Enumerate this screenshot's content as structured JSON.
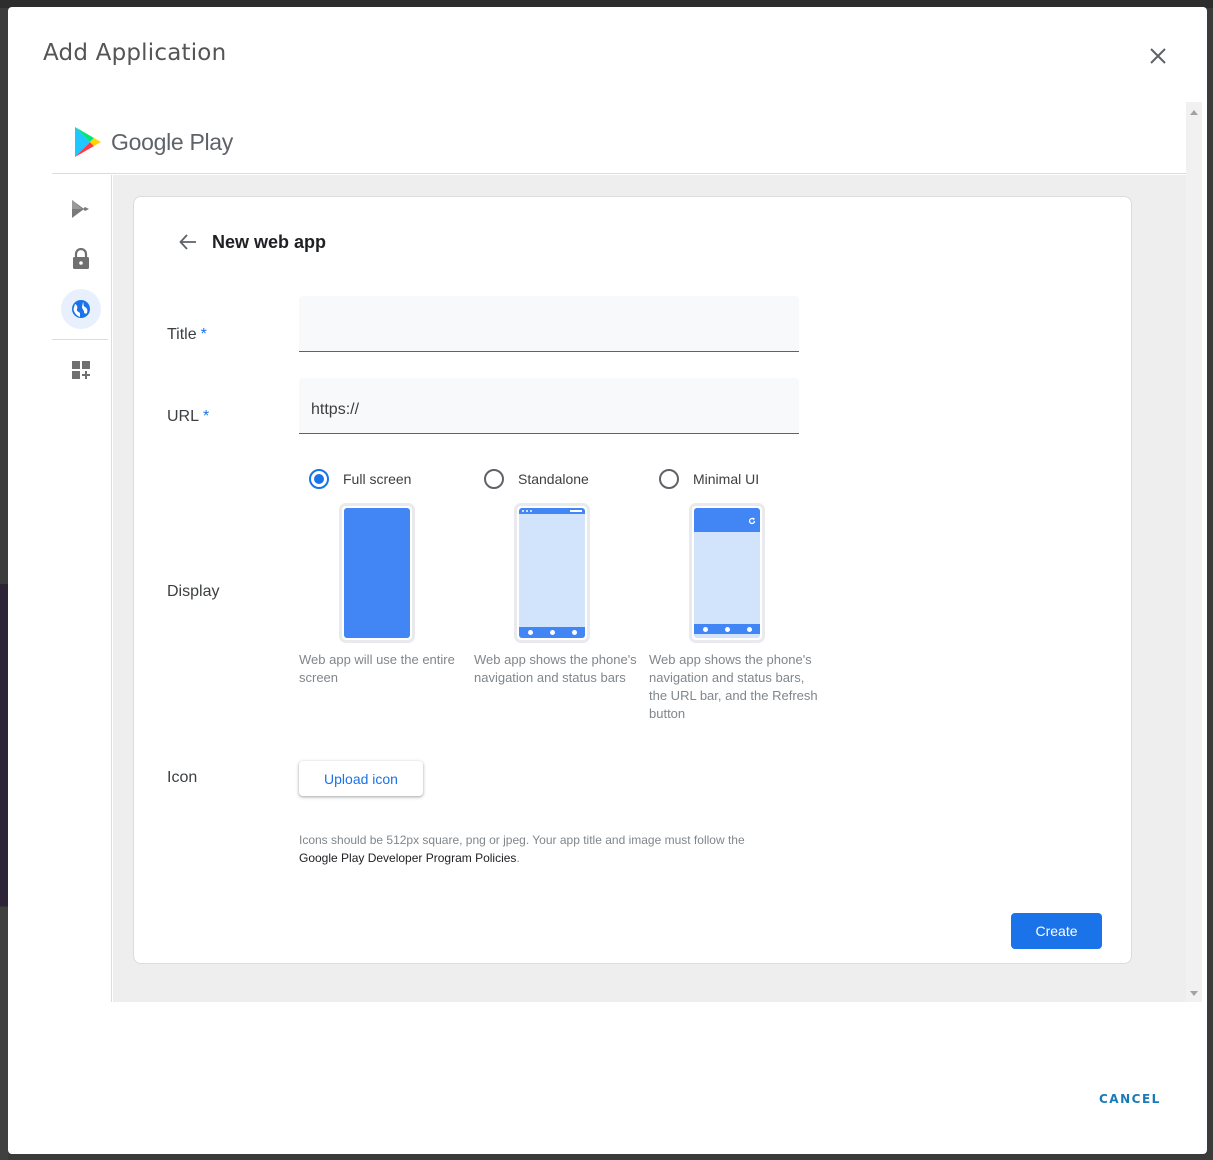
{
  "dialog": {
    "title": "Add Application",
    "close_icon": "close-icon",
    "cancel_label": "CANCEL"
  },
  "google_play": {
    "logo_text": "Google Play",
    "logo_icon": "google-play-logo-icon"
  },
  "rail": {
    "items": [
      {
        "name": "managed-play-apps",
        "icon": "play-apps-icon",
        "active": false
      },
      {
        "name": "private-apps",
        "icon": "lock-icon",
        "active": false
      },
      {
        "name": "web-apps",
        "icon": "globe-icon",
        "active": true
      },
      {
        "name": "organize-apps",
        "icon": "apps-add-icon",
        "active": false
      }
    ]
  },
  "form": {
    "back_icon": "arrow-back-icon",
    "heading": "New web app",
    "required_marker": "*",
    "title_field": {
      "label": "Title",
      "value": "",
      "required": true
    },
    "url_field": {
      "label": "URL",
      "value": "https://",
      "required": true
    },
    "display": {
      "label": "Display",
      "selected": "Full screen",
      "options": [
        {
          "label": "Full screen",
          "checked": true,
          "description": "Web app will use the entire screen"
        },
        {
          "label": "Standalone",
          "checked": false,
          "description": "Web app shows the phone's navigation and status bars"
        },
        {
          "label": "Minimal UI",
          "checked": false,
          "description": "Web app shows the phone's navigation and status bars, the URL bar, and the Refresh button"
        }
      ]
    },
    "icon": {
      "label": "Icon",
      "upload_label": "Upload icon",
      "help_text": "Icons should be 512px square, png or jpeg. Your app title and image must follow the",
      "policy_link": "Google Play Developer Program Policies",
      "help_suffix": "."
    },
    "create_label": "Create"
  },
  "colors": {
    "accent": "#1a73e8",
    "phone_primary": "#4285f4",
    "phone_light": "#d2e3fc",
    "cancel": "#1a7ab8"
  }
}
